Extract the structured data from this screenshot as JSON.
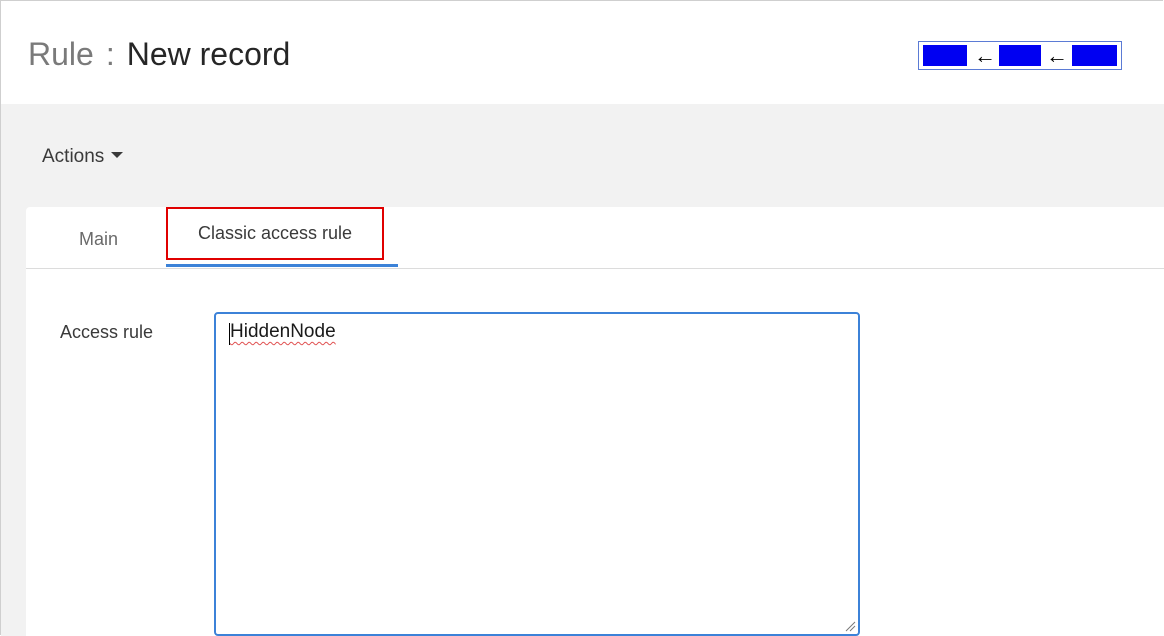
{
  "header": {
    "model_name": "Rule",
    "separator": ":",
    "record_name": "New record"
  },
  "nav_widget": {
    "arrow_1": "←",
    "arrow_2": "←",
    "block_color": "#0000f2"
  },
  "toolbar": {
    "actions_label": "Actions"
  },
  "tabs": [
    {
      "label": "Main",
      "active": false
    },
    {
      "label": "Classic access rule",
      "active": true
    }
  ],
  "form": {
    "access_rule_label": "Access rule",
    "access_rule_value": "HiddenNode"
  },
  "colors": {
    "accent": "#3c82d8",
    "highlight_box": "#e00000",
    "toolbar_bg": "#f2f2f2"
  }
}
